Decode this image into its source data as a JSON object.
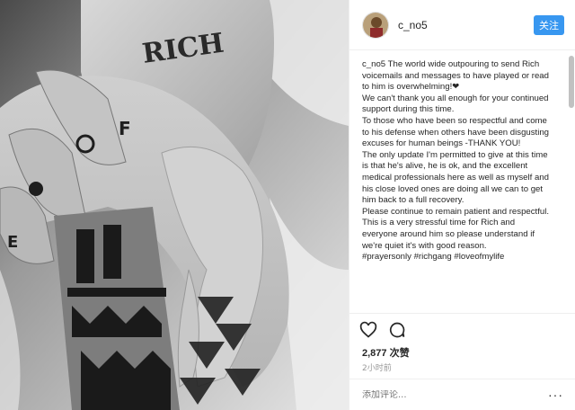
{
  "header": {
    "username": "c_no5",
    "follow_label": "关注"
  },
  "photo": {
    "tattoo_wrist_text": "RICH",
    "tattoo_finger_texts": [
      "F",
      "O",
      "E"
    ],
    "description": "Black and white photo of two tattooed hands holding each other"
  },
  "caption": {
    "username": "c_no5",
    "lines": [
      "The world wide outpouring to send Rich voicemails and messages to have played or read to him is overwhelming!❤",
      "We can't thank you all enough for your continued support during this time.",
      "To those who have been so respectful and come to his defense when others have been disgusting excuses for human beings -THANK YOU!",
      "The only update I'm permitted to give at this time is that he's alive, he is ok, and the excellent medical professionals here as well as myself and his close loved ones are doing all we can to get him back to a full recovery.",
      "Please continue to remain patient and respectful.",
      "This is a very stressful time for Rich and everyone around him so please understand if we're quiet it's with good reason.",
      "#prayersonly #richgang #loveofmylife"
    ]
  },
  "actions": {
    "like_icon": "heart-icon",
    "comment_icon": "comment-icon"
  },
  "stats": {
    "likes": "2,877 次赞",
    "time_ago": "2小时前"
  },
  "comment": {
    "placeholder": "添加评论...",
    "more_icon": "ellipsis-icon",
    "more_glyph": "···"
  },
  "colors": {
    "follow_button": "#3897f0",
    "border": "#efefef",
    "text": "#262626",
    "muted": "#999999"
  }
}
